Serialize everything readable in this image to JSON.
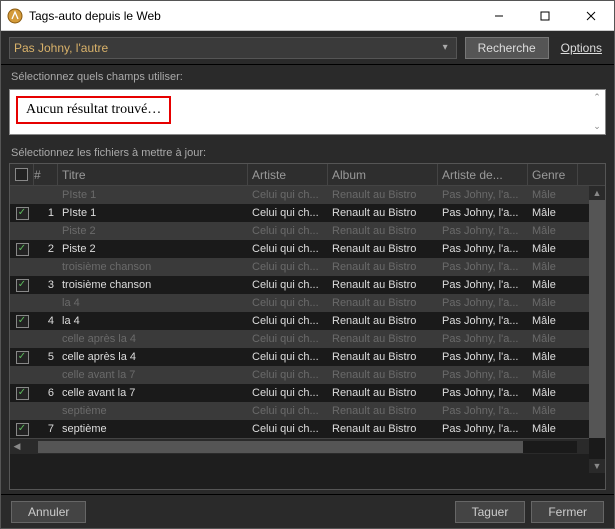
{
  "window": {
    "title": "Tags-auto depuis le Web"
  },
  "toolbar": {
    "search_value": "Pas Johny, l'autre",
    "search_btn": "Recherche",
    "options_link": "Options"
  },
  "sections": {
    "fields_label": "Sélectionnez quels champs utiliser:",
    "files_label": "Sélectionnez les fichiers à mettre à jour:"
  },
  "result": {
    "message": "Aucun résultat trouvé…"
  },
  "columns": {
    "num": "#",
    "title": "Titre",
    "artist": "Artiste",
    "album": "Album",
    "album_artist": "Artiste de...",
    "genre": "Genre"
  },
  "rows": [
    {
      "dim": true,
      "stripe": true,
      "checked": false,
      "num": "",
      "title": "PIste 1",
      "artist": "Celui qui ch...",
      "album": "Renault au Bistro",
      "album_artist": "Pas Johny, l'a...",
      "genre": "Mâle"
    },
    {
      "dim": false,
      "stripe": false,
      "checked": true,
      "num": "1",
      "title": "PIste 1",
      "artist": "Celui qui ch...",
      "album": "Renault au Bistro",
      "album_artist": "Pas Johny, l'a...",
      "genre": "Mâle"
    },
    {
      "dim": true,
      "stripe": true,
      "checked": false,
      "num": "",
      "title": "Piste 2",
      "artist": "Celui qui ch...",
      "album": "Renault au Bistro",
      "album_artist": "Pas Johny, l'a...",
      "genre": "Mâle"
    },
    {
      "dim": false,
      "stripe": false,
      "checked": true,
      "num": "2",
      "title": "Piste 2",
      "artist": "Celui qui ch...",
      "album": "Renault au Bistro",
      "album_artist": "Pas Johny, l'a...",
      "genre": "Mâle"
    },
    {
      "dim": true,
      "stripe": true,
      "checked": false,
      "num": "",
      "title": "troisième chanson",
      "artist": "Celui qui ch...",
      "album": "Renault au Bistro",
      "album_artist": "Pas Johny, l'a...",
      "genre": "Mâle"
    },
    {
      "dim": false,
      "stripe": false,
      "checked": true,
      "num": "3",
      "title": "troisième chanson",
      "artist": "Celui qui ch...",
      "album": "Renault au Bistro",
      "album_artist": "Pas Johny, l'a...",
      "genre": "Mâle"
    },
    {
      "dim": true,
      "stripe": true,
      "checked": false,
      "num": "",
      "title": "la 4",
      "artist": "Celui qui ch...",
      "album": "Renault au Bistro",
      "album_artist": "Pas Johny, l'a...",
      "genre": "Mâle"
    },
    {
      "dim": false,
      "stripe": false,
      "checked": true,
      "num": "4",
      "title": "la 4",
      "artist": "Celui qui ch...",
      "album": "Renault au Bistro",
      "album_artist": "Pas Johny, l'a...",
      "genre": "Mâle"
    },
    {
      "dim": true,
      "stripe": true,
      "checked": false,
      "num": "",
      "title": "celle après la 4",
      "artist": "Celui qui ch...",
      "album": "Renault au Bistro",
      "album_artist": "Pas Johny, l'a...",
      "genre": "Mâle"
    },
    {
      "dim": false,
      "stripe": false,
      "checked": true,
      "num": "5",
      "title": "celle après la 4",
      "artist": "Celui qui ch...",
      "album": "Renault au Bistro",
      "album_artist": "Pas Johny, l'a...",
      "genre": "Mâle"
    },
    {
      "dim": true,
      "stripe": true,
      "checked": false,
      "num": "",
      "title": "celle avant la 7",
      "artist": "Celui qui ch...",
      "album": "Renault au Bistro",
      "album_artist": "Pas Johny, l'a...",
      "genre": "Mâle"
    },
    {
      "dim": false,
      "stripe": false,
      "checked": true,
      "num": "6",
      "title": "celle avant la 7",
      "artist": "Celui qui ch...",
      "album": "Renault au Bistro",
      "album_artist": "Pas Johny, l'a...",
      "genre": "Mâle"
    },
    {
      "dim": true,
      "stripe": true,
      "checked": false,
      "num": "",
      "title": "septième",
      "artist": "Celui qui ch...",
      "album": "Renault au Bistro",
      "album_artist": "Pas Johny, l'a...",
      "genre": "Mâle"
    },
    {
      "dim": false,
      "stripe": false,
      "checked": true,
      "num": "7",
      "title": "septième",
      "artist": "Celui qui ch...",
      "album": "Renault au Bistro",
      "album_artist": "Pas Johny, l'a...",
      "genre": "Mâle"
    }
  ],
  "footer": {
    "cancel": "Annuler",
    "tag": "Taguer",
    "close": "Fermer"
  }
}
